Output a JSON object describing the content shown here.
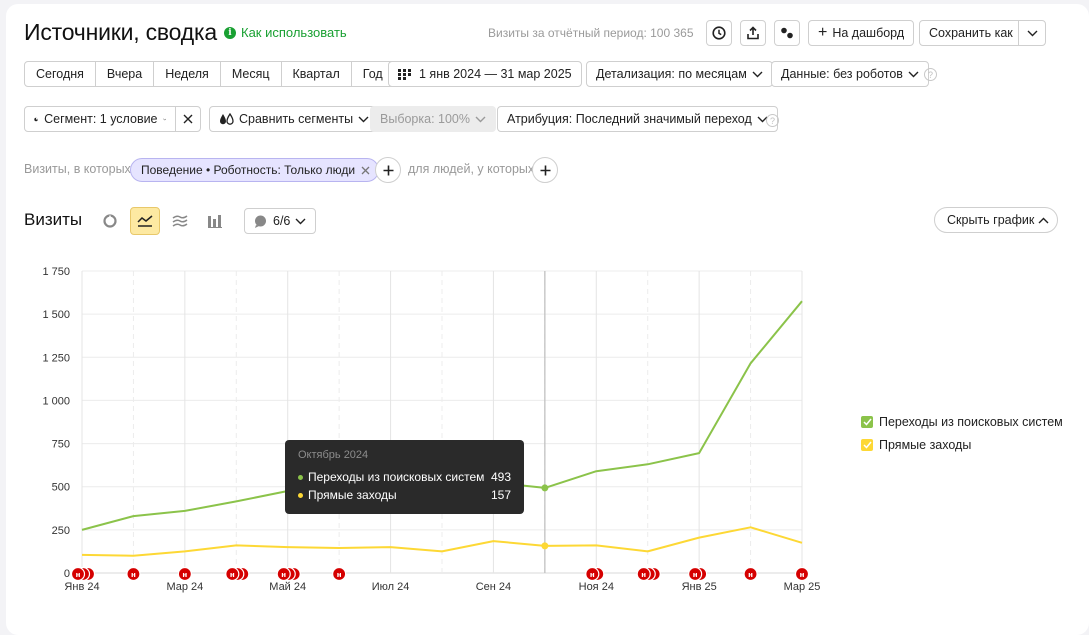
{
  "header": {
    "title": "Источники, сводка",
    "howto": "Как использовать",
    "visits_total": "Визиты за отчётный период: 100 365",
    "to_dashboard": "На дашборд",
    "save_as": "Сохранить как"
  },
  "periods": [
    "Сегодня",
    "Вчера",
    "Неделя",
    "Месяц",
    "Квартал",
    "Год"
  ],
  "date_range": "1 янв 2024 — 31 мар 2025",
  "detail": "Детализация: по месяцам",
  "data_filter": "Данные: без роботов",
  "segment": "Сегмент: 1 условие",
  "compare": "Сравнить сегменты",
  "sample": "Выборка: 100%",
  "attribution": "Атрибуция: Последний значимый переход",
  "filters": {
    "visits_label": "Визиты, в которых",
    "chip": "Поведение • Роботность: Только люди",
    "people_label": "для людей, у которых"
  },
  "section_title": "Визиты",
  "annotations_count": "6/6",
  "hide_chart": "Скрыть график",
  "colors": {
    "search": "#8bc34a",
    "direct": "#fdd835",
    "accent": "#19a032",
    "annotation": "#d50000"
  },
  "tooltip": {
    "title": "Октябрь 2024",
    "rows": [
      {
        "name": "Переходы из поисковых систем",
        "value": "493"
      },
      {
        "name": "Прямые заходы",
        "value": "157"
      }
    ]
  },
  "chart_data": {
    "type": "line",
    "x": [
      "2024-01",
      "2024-02",
      "2024-03",
      "2024-04",
      "2024-05",
      "2024-06",
      "2024-07",
      "2024-08",
      "2024-09",
      "2024-10",
      "2024-11",
      "2024-12",
      "2025-01",
      "2025-02",
      "2025-03"
    ],
    "x_tick_labels": [
      "Янв 24",
      "Мар 24",
      "Май 24",
      "Июл 24",
      "Сен 24",
      "Ноя 24",
      "Янв 25",
      "Мар 25"
    ],
    "y_tick_labels": [
      "0",
      "250",
      "500",
      "750",
      "1 000",
      "1 250",
      "1 500",
      "1 750"
    ],
    "ylim": [
      0,
      1750
    ],
    "grid": true,
    "legend_position": "right",
    "series": [
      {
        "name": "Переходы из поисковых систем",
        "values": [
          250,
          330,
          360,
          415,
          475,
          505,
          550,
          520,
          525,
          493,
          590,
          630,
          695,
          1215,
          1575
        ]
      },
      {
        "name": "Прямые заходы",
        "values": [
          105,
          100,
          125,
          160,
          150,
          145,
          150,
          125,
          185,
          157,
          160,
          125,
          205,
          265,
          175
        ]
      }
    ]
  }
}
